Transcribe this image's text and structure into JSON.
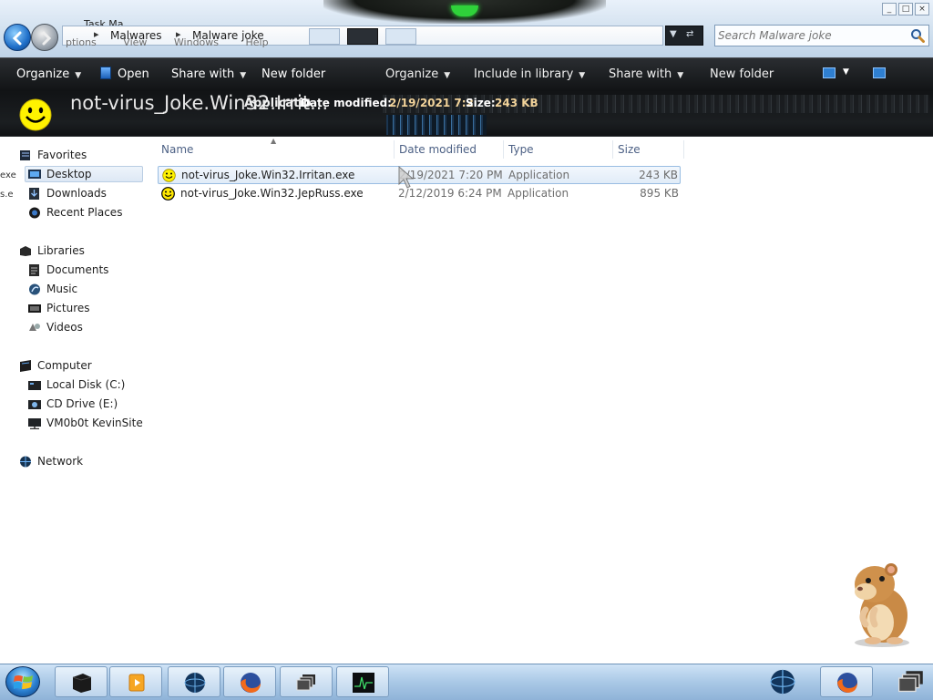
{
  "window": {
    "ghost_title": "Task Ma",
    "ghost_menu": [
      "ptions",
      "View",
      "Windows",
      "Help"
    ],
    "controls": [
      "_",
      "□",
      "×"
    ]
  },
  "address": {
    "crumbs": [
      "Malwares",
      "Malware joke"
    ]
  },
  "search": {
    "placeholder": "Search Malware joke"
  },
  "toolbar": {
    "organize": "Organize",
    "open": "Open",
    "share_with": "Share with",
    "new_folder": "New folder",
    "organize_dup": "Organize",
    "include_in_library": "Include in library",
    "share_with_dup": "Share with",
    "new_folder_dup": "New folder"
  },
  "details": {
    "filename": "not-virus_Joke.Win32.Irrit...",
    "type": "Applicatio",
    "date_label": "Date modified:",
    "date_value": "2/19/2021 7:2",
    "size_label": "Size:",
    "size_value": "243 KB"
  },
  "nav": {
    "favorites": "Favorites",
    "desktop": "Desktop",
    "downloads": "Downloads",
    "recent_places": "Recent Places",
    "libraries": "Libraries",
    "documents": "Documents",
    "music": "Music",
    "pictures": "Pictures",
    "videos": "Videos",
    "computer": "Computer",
    "local_disk": "Local Disk (C:)",
    "cd_drive": "CD Drive (E:)",
    "network_share": "VM0b0t KevinSite",
    "network": "Network",
    "edge_fragments": [
      "exe",
      "s.e"
    ]
  },
  "columns": {
    "name": "Name",
    "date_modified": "Date modified",
    "type": "Type",
    "size": "Size"
  },
  "files": [
    {
      "name": "not-virus_Joke.Win32.Irritan.exe",
      "date": "2/19/2021 7:20 PM",
      "type": "Application",
      "size": "243 KB",
      "selected": true
    },
    {
      "name": "not-virus_Joke.Win32.JepRuss.exe",
      "date": "2/12/2019 6:24 PM",
      "type": "Application",
      "size": "895 KB",
      "selected": false
    }
  ],
  "colors": {
    "command_bar": "#17191b",
    "selection": "#dde8f5",
    "detail_value": "#f2d39a",
    "taskbar": "#a9c8e6"
  },
  "icons": {
    "app": "smiley-icon",
    "taskbar": [
      "windows-orb-icon",
      "black-box-icon",
      "media-player-icon",
      "globe-icon",
      "firefox-icon",
      "window-switcher-icon",
      "task-manager-icon",
      "globe-icon",
      "firefox-icon",
      "window-switcher-icon"
    ]
  }
}
